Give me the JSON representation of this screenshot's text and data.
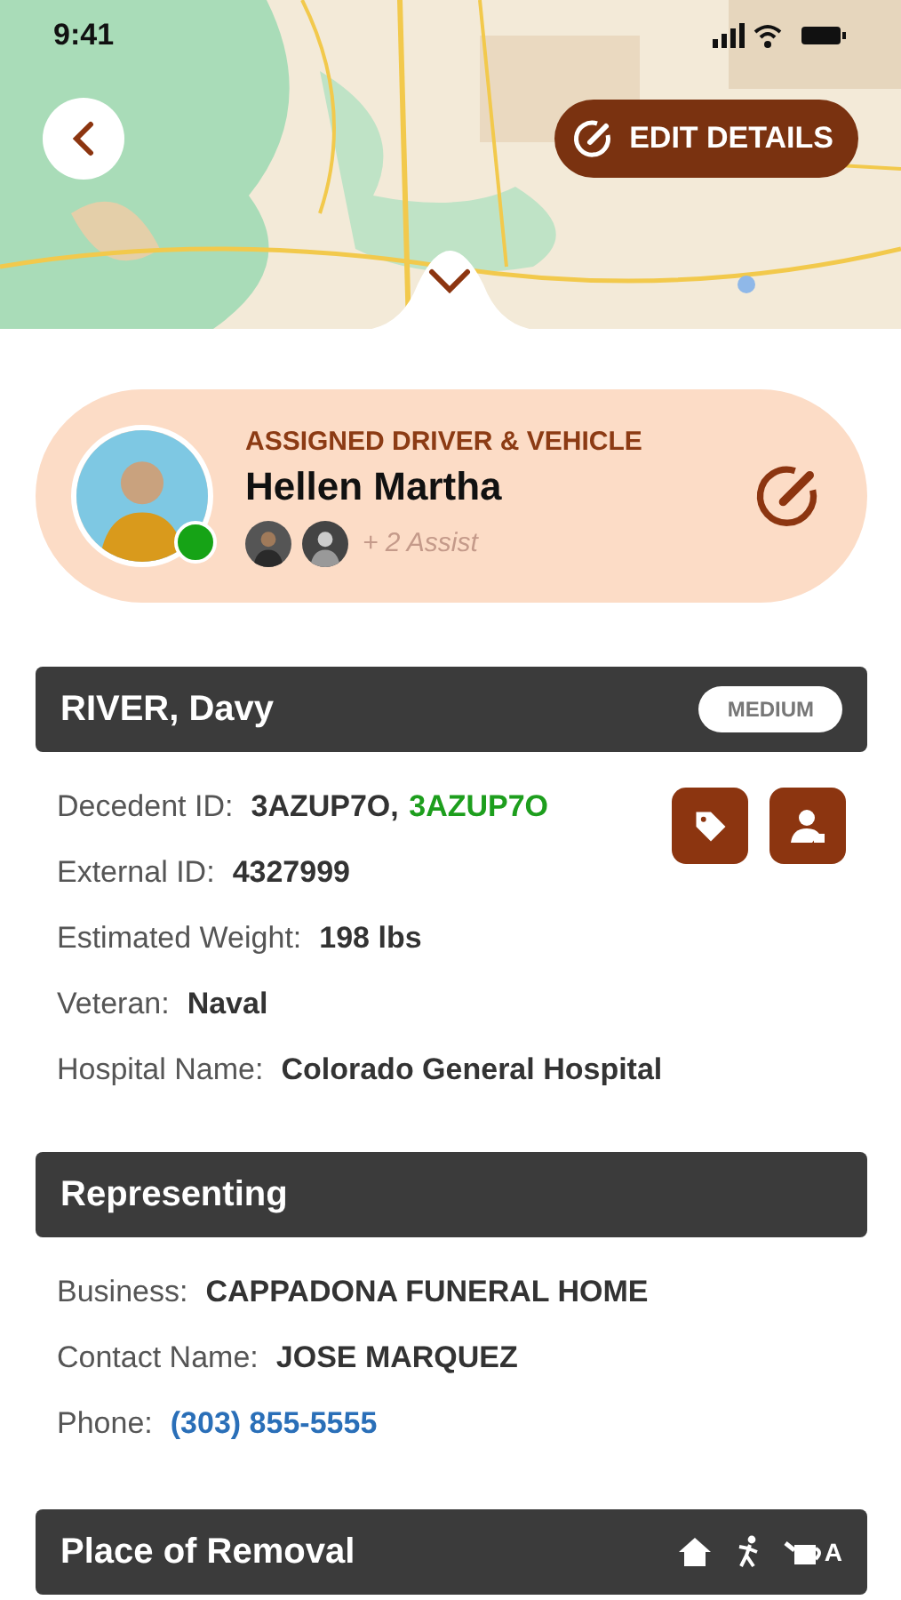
{
  "status_bar": {
    "time": "9:41"
  },
  "header": {
    "edit_button": "EDIT DETAILS"
  },
  "driver_card": {
    "caption": "ASSIGNED DRIVER & VEHICLE",
    "name": "Hellen Martha",
    "online": true,
    "assist": "+ 2 Assist"
  },
  "decedent": {
    "name": "RIVER, Davy",
    "badge": "MEDIUM",
    "rows": [
      {
        "label": "Decedent ID:",
        "values": [
          {
            "text": "3AZUP7O,",
            "highlight": false
          },
          {
            "text": "3AZUP7O",
            "highlight": true
          }
        ]
      },
      {
        "label": "External ID:",
        "values": [
          {
            "text": "4327999",
            "highlight": false
          }
        ]
      },
      {
        "label": "Estimated Weight:",
        "values": [
          {
            "text": "198 lbs",
            "highlight": false
          }
        ]
      },
      {
        "label": "Veteran:",
        "values": [
          {
            "text": "Naval",
            "highlight": false
          }
        ]
      },
      {
        "label": "Hospital Name:",
        "values": [
          {
            "text": "Colorado General Hospital",
            "highlight": false
          }
        ]
      }
    ]
  },
  "representing": {
    "title": "Representing",
    "rows": [
      {
        "label": "Business:",
        "value": "CAPPADONA FUNERAL HOME",
        "kind": "text"
      },
      {
        "label": "Contact Name:",
        "value": "JOSE MARQUEZ",
        "kind": "text"
      },
      {
        "label": "Phone:",
        "value": "(303) 855-5555",
        "kind": "phone"
      }
    ]
  },
  "place_of_removal": {
    "title": "Place of Removal",
    "icon_label": "A"
  }
}
